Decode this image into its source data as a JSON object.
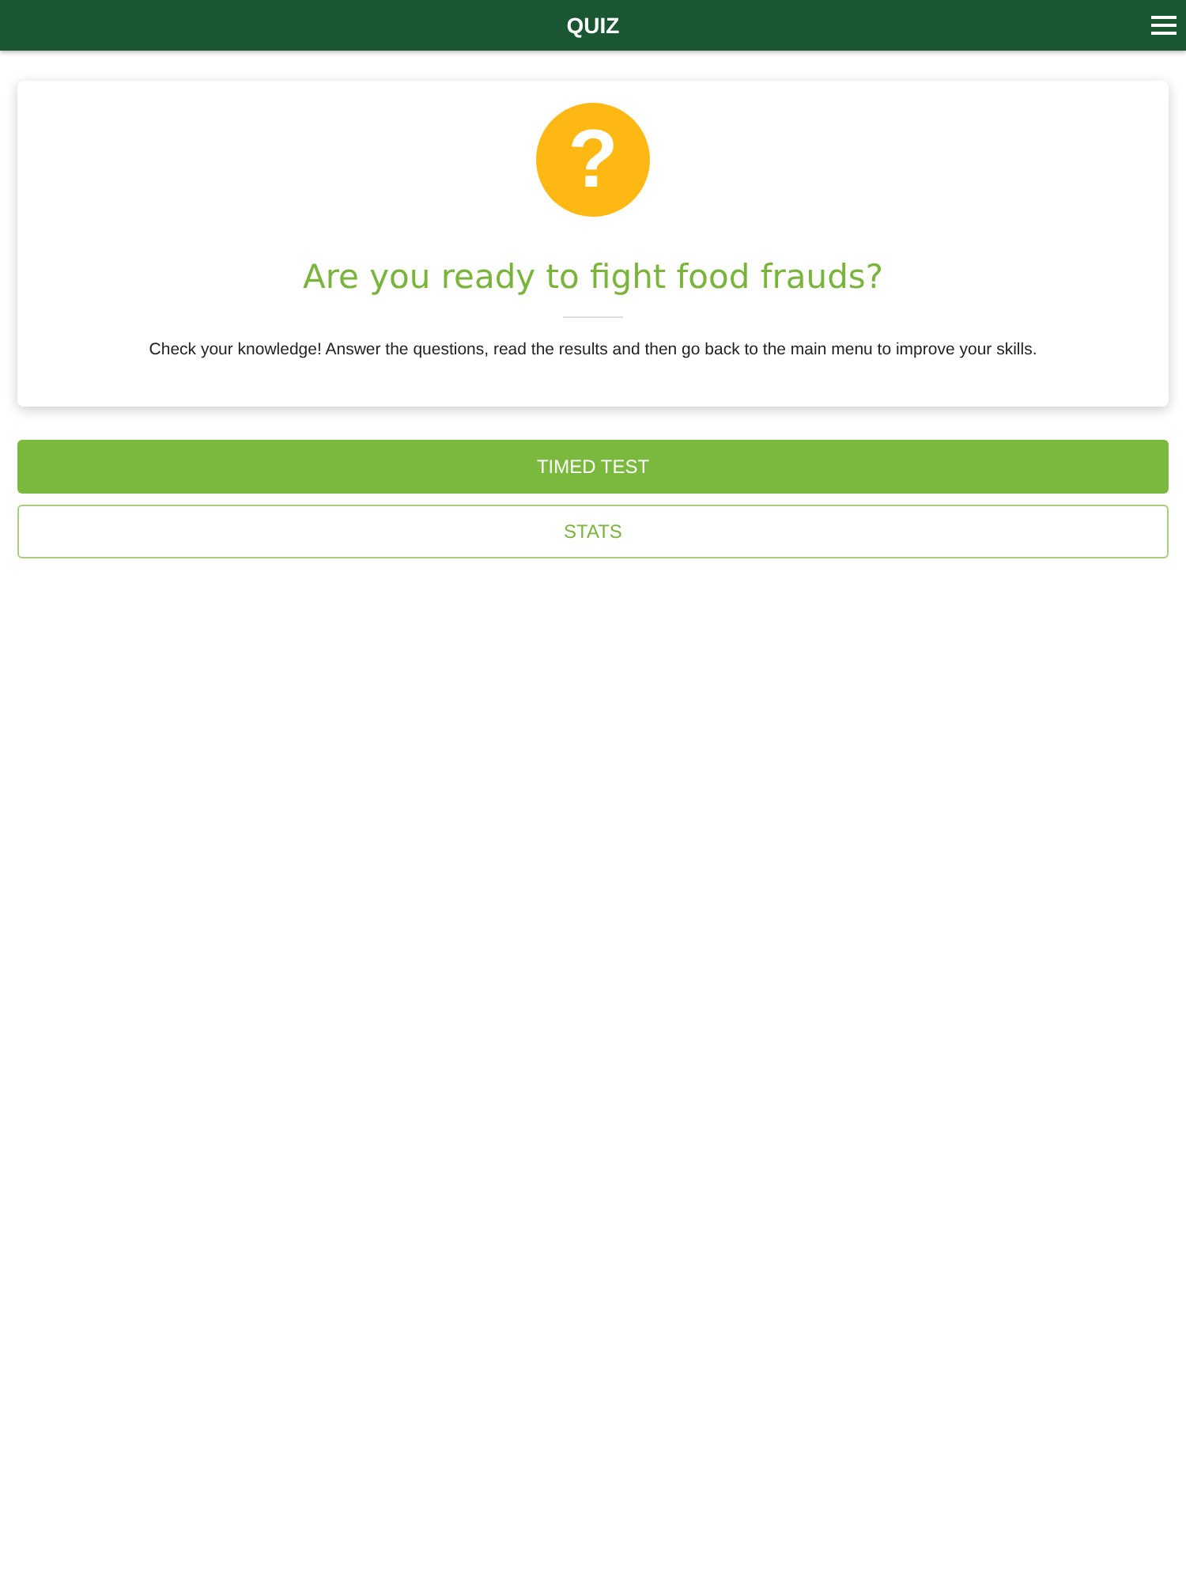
{
  "header": {
    "title": "QUIZ"
  },
  "intro": {
    "icon_glyph": "?",
    "heading": "Are you ready to fight food frauds?",
    "text": "Check your knowledge! Answer the questions, read the results and then go back to the main menu to improve your skills."
  },
  "buttons": [
    {
      "label": "TIMED TEST",
      "kind": "filled"
    },
    {
      "label": "STATS",
      "kind": "outline"
    }
  ]
}
